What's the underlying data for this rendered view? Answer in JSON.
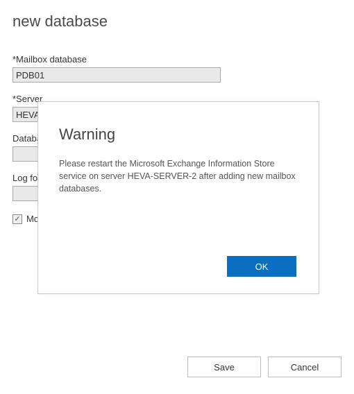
{
  "page": {
    "title": "new database"
  },
  "form": {
    "mailbox_label": "*Mailbox database",
    "mailbox_value": "PDB01",
    "server_label": "*Server",
    "server_value": "HEVA-",
    "dbfile_label": "Databa",
    "dbfile_value": "",
    "logfolder_label": "Log fol",
    "logfolder_value": "",
    "mount_label_partial": "Mo",
    "mount_checked": true
  },
  "dialog": {
    "title": "Warning",
    "body": "Please restart the Microsoft Exchange Information Store service on server HEVA-SERVER-2 after adding new mailbox databases.",
    "ok": "OK"
  },
  "actions": {
    "save": "Save",
    "cancel": "Cancel"
  }
}
